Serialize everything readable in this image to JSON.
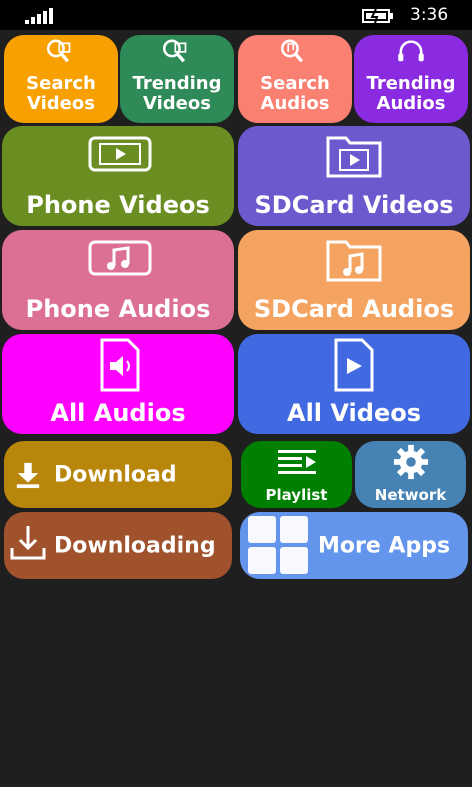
{
  "status": {
    "time": "3:36",
    "signal_icon": "signal-bars-icon",
    "battery_icon": "battery-charging-icon"
  },
  "tiles": {
    "search_videos": {
      "line1": "Search",
      "line2": "Videos",
      "color": "#f7a000"
    },
    "trending_videos": {
      "line1": "Trending",
      "line2": "Videos",
      "color": "#2e8b57"
    },
    "search_audios": {
      "line1": "Search",
      "line2": "Audios",
      "color": "#fa8072"
    },
    "trending_audios": {
      "line1": "Trending",
      "line2": "Audios",
      "color": "#8a2be2"
    },
    "phone_videos": {
      "label": "Phone Videos",
      "color": "#6b8e23"
    },
    "sdcard_videos": {
      "label": "SDCard Videos",
      "color": "#6a5acd"
    },
    "phone_audios": {
      "label": "Phone Audios",
      "color": "#db7093"
    },
    "sdcard_audios": {
      "label": "SDCard Audios",
      "color": "#f4a460"
    },
    "all_audios": {
      "label": "All Audios",
      "color": "#ff00ff"
    },
    "all_videos": {
      "label": "All Videos",
      "color": "#4169e1"
    },
    "download": {
      "label": "Download",
      "color": "#b8860b"
    },
    "playlist": {
      "label": "Playlist",
      "color": "#008000"
    },
    "network": {
      "label": "Network",
      "color": "#4682b4"
    },
    "downloading": {
      "label": "Downloading",
      "color": "#a0522d"
    },
    "more_apps": {
      "label": "More Apps",
      "color": "#6495ed"
    }
  }
}
